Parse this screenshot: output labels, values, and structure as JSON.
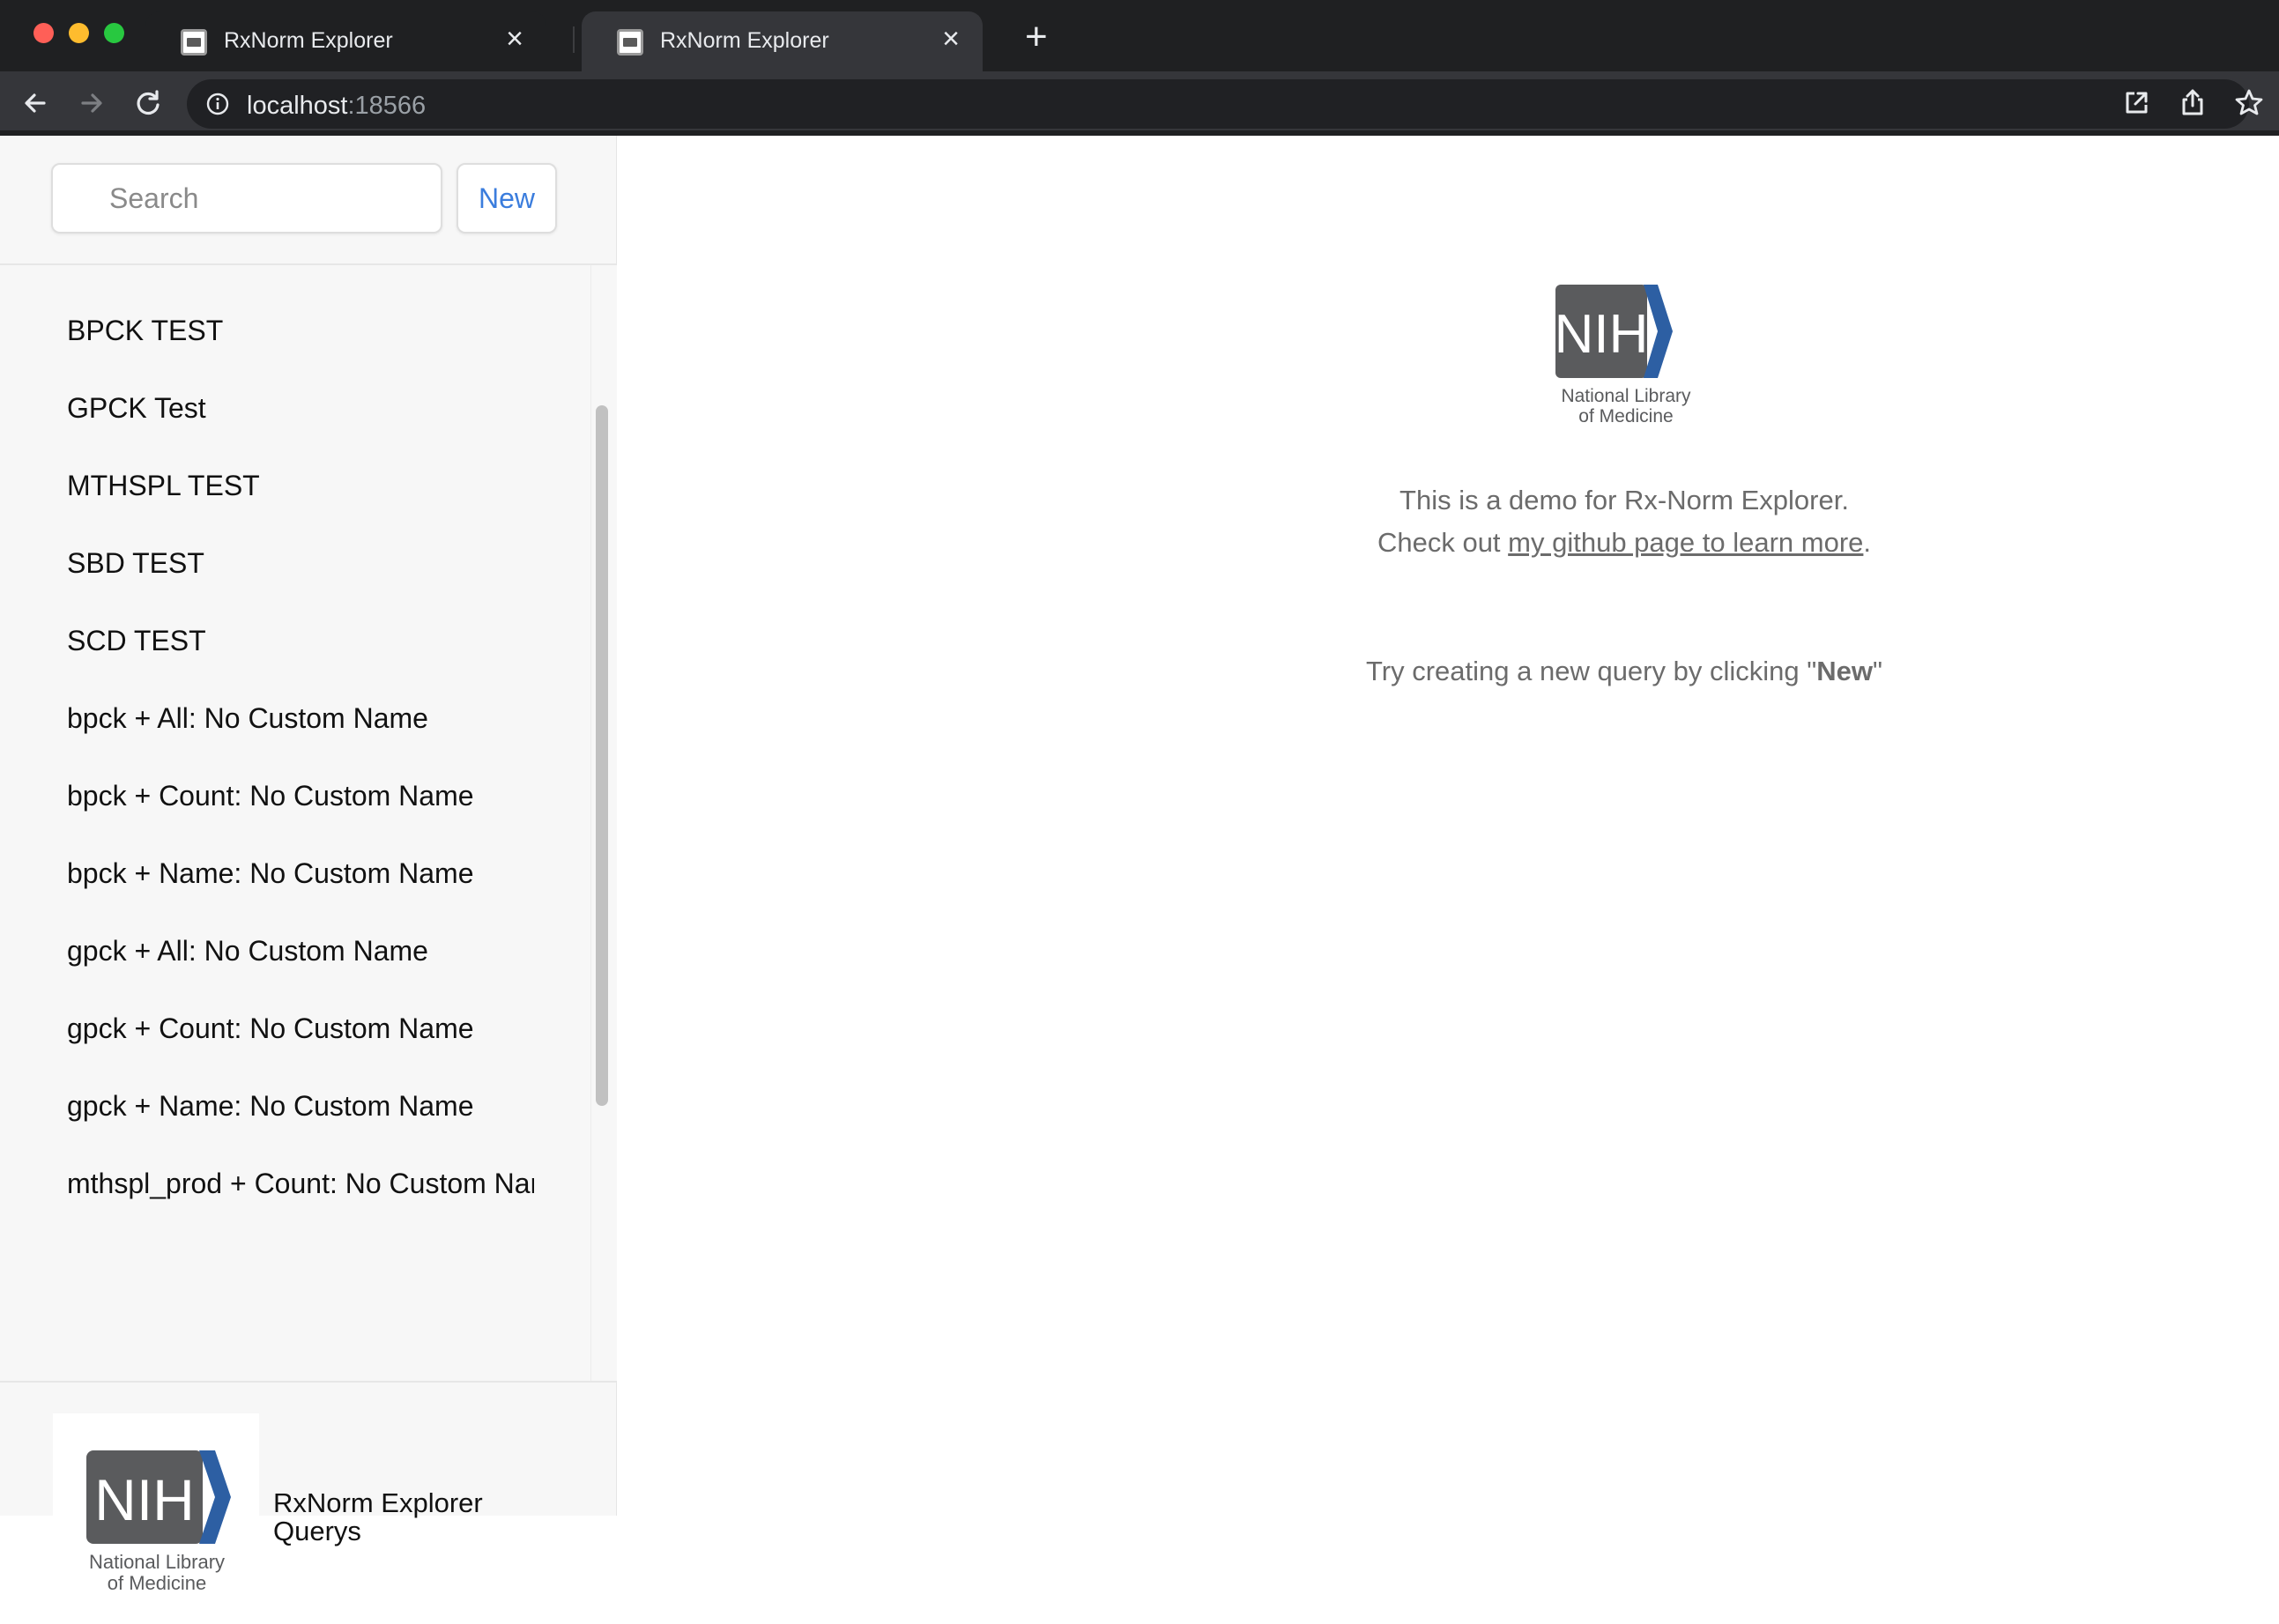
{
  "browser": {
    "tabs": [
      {
        "title": "RxNorm Explorer",
        "active": false
      },
      {
        "title": "RxNorm Explorer",
        "active": true
      }
    ],
    "url_host": "localhost",
    "url_port": ":18566"
  },
  "sidebar": {
    "search_placeholder": "Search",
    "new_button_label": "New",
    "queries": [
      "BPCK TEST",
      "GPCK Test",
      "MTHSPL TEST",
      "SBD TEST",
      "SCD TEST",
      "bpck + All: No Custom Name",
      "bpck + Count: No Custom Name",
      "bpck + Name: No Custom Name",
      "gpck + All: No Custom Name",
      "gpck + Count: No Custom Name",
      "gpck + Name: No Custom Name",
      "mthspl_prod + Count: No Custom Name"
    ],
    "footer_title": "RxNorm Explorer Querys"
  },
  "logo": {
    "mark": "NIH",
    "line1": "National Library",
    "line2": "of Medicine"
  },
  "main": {
    "intro_line1": "This is a demo for Rx-Norm Explorer.",
    "intro_prefix": "Check out ",
    "intro_link": "my github page to learn more",
    "intro_suffix": ".",
    "hint_prefix": "Try creating a new query by clicking \"",
    "hint_bold": "New",
    "hint_suffix": "\""
  },
  "colors": {
    "accent": "#3b7ddd",
    "nih_gray": "#5a5b5d",
    "nih_blue": "#2d5fa3"
  }
}
